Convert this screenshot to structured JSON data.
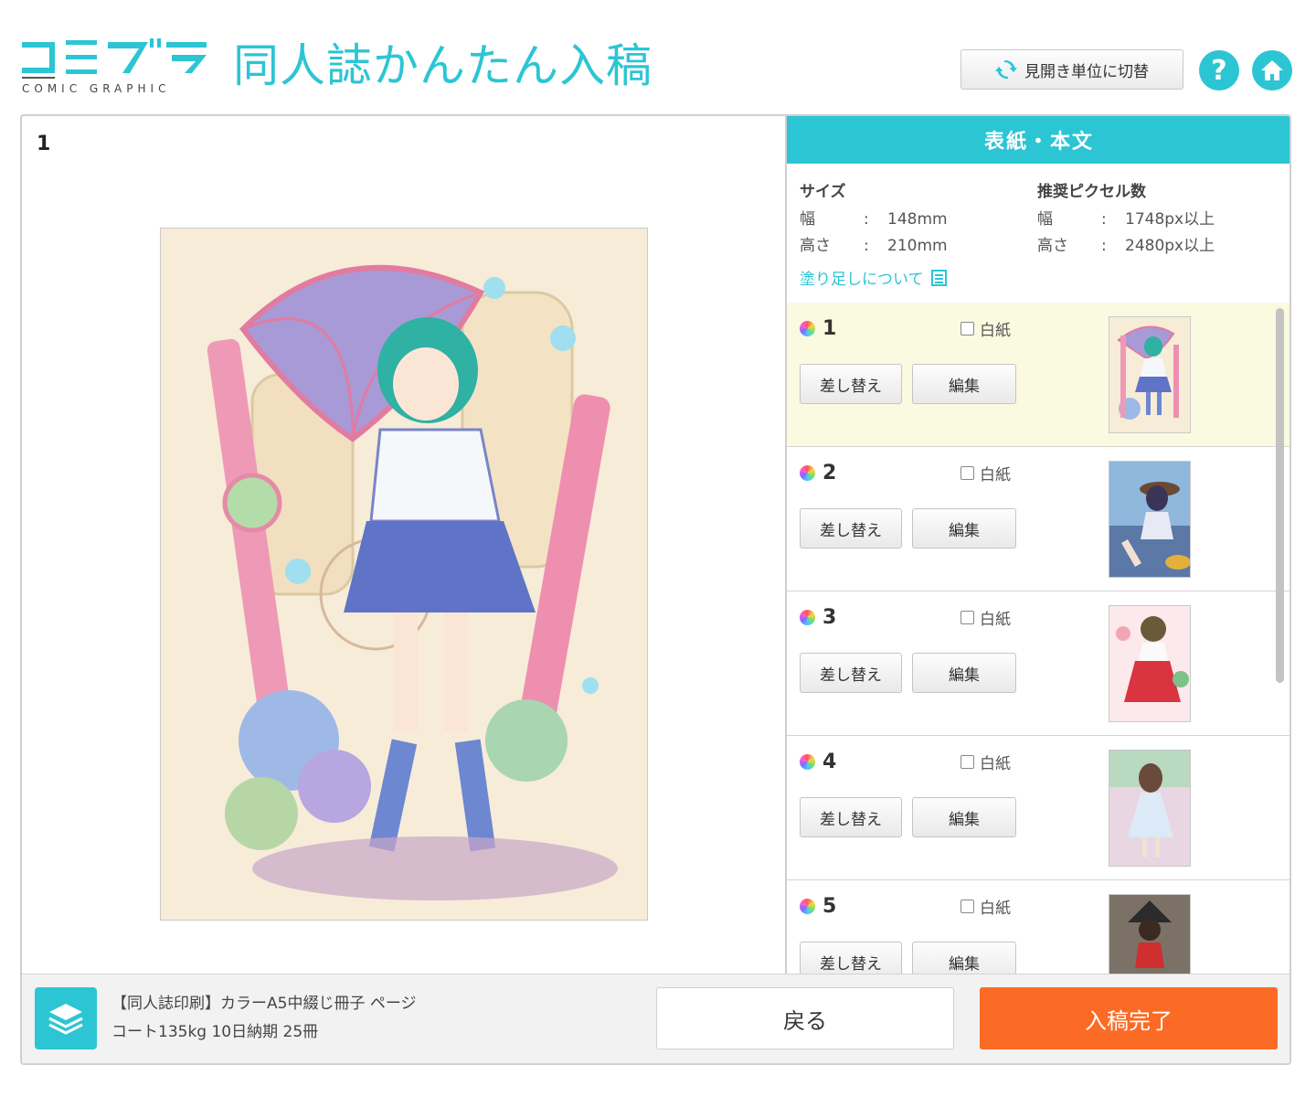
{
  "header": {
    "logo_text": "コミグラ",
    "logo_sub": "COMIC GRAPHIC",
    "title": "同人誌かんたん入稿",
    "switch_label": "見開き単位に切替",
    "help_label": "?",
    "icons": [
      "refresh-icon",
      "help-icon",
      "home-icon"
    ]
  },
  "preview": {
    "page_number": "1"
  },
  "panel": {
    "title": "表紙・本文",
    "size_title": "サイズ",
    "width_label": "幅",
    "height_label": "高さ",
    "separator": ":",
    "width_value": "148mm",
    "height_value": "210mm",
    "pixel_title": "推奨ピクセル数",
    "pixel_width_value": "1748px以上",
    "pixel_height_value": "2480px以上",
    "bleed_link": "塗り足しについて"
  },
  "pages": [
    {
      "number": "1",
      "blank_label": "白紙",
      "replace_label": "差し替え",
      "edit_label": "編集",
      "selected": true
    },
    {
      "number": "2",
      "blank_label": "白紙",
      "replace_label": "差し替え",
      "edit_label": "編集",
      "selected": false
    },
    {
      "number": "3",
      "blank_label": "白紙",
      "replace_label": "差し替え",
      "edit_label": "編集",
      "selected": false
    },
    {
      "number": "4",
      "blank_label": "白紙",
      "replace_label": "差し替え",
      "edit_label": "編集",
      "selected": false
    },
    {
      "number": "5",
      "blank_label": "白紙",
      "replace_label": "差し替え",
      "edit_label": "編集",
      "selected": false
    }
  ],
  "footer": {
    "product_line1": "【同人誌印刷】カラーA5中綴じ冊子 ページ",
    "product_line2": "コート135kg 10日納期 25冊",
    "back_label": "戻る",
    "done_label": "入稿完了"
  },
  "colors": {
    "accent": "#2cc5d4",
    "done": "#fb6b25",
    "selected_row": "#fafae0"
  }
}
